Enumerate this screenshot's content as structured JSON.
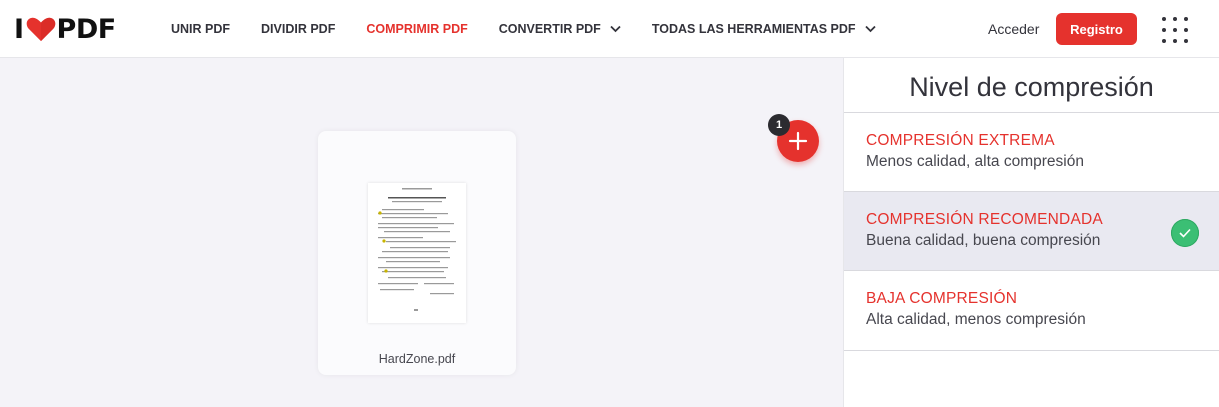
{
  "header": {
    "logo": {
      "left": "I",
      "right": "PDF",
      "heart_color": "#e5322d"
    },
    "nav": [
      {
        "label": "UNIR PDF",
        "active": false,
        "dropdown": false
      },
      {
        "label": "DIVIDIR PDF",
        "active": false,
        "dropdown": false
      },
      {
        "label": "COMPRIMIR PDF",
        "active": true,
        "dropdown": false
      },
      {
        "label": "CONVERTIR PDF",
        "active": false,
        "dropdown": true
      },
      {
        "label": "TODAS LAS HERRAMIENTAS PDF",
        "active": false,
        "dropdown": true
      }
    ],
    "login_label": "Acceder",
    "register_label": "Registro",
    "apps_icon": "grid-dots-icon"
  },
  "workspace": {
    "file": {
      "name": "HardZone.pdf"
    },
    "file_count": "1",
    "add_icon": "plus-icon"
  },
  "panel": {
    "title": "Nivel de compresión",
    "options": [
      {
        "title": "COMPRESIÓN EXTREMA",
        "subtitle": "Menos calidad, alta compresión",
        "selected": false
      },
      {
        "title": "COMPRESIÓN RECOMENDADA",
        "subtitle": "Buena calidad, buena compresión",
        "selected": true
      },
      {
        "title": "BAJA COMPRESIÓN",
        "subtitle": "Alta calidad, menos compresión",
        "selected": false
      }
    ],
    "selected_icon": "check-icon"
  },
  "colors": {
    "accent": "#e5322d",
    "success": "#3bbf74",
    "text": "#33333b",
    "background": "#f4f3f8"
  }
}
